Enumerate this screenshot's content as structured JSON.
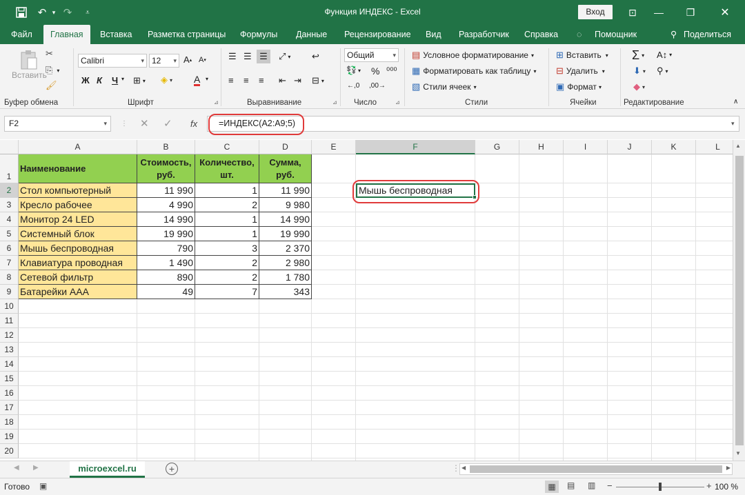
{
  "titlebar": {
    "title": "Функция ИНДЕКС  -  Excel",
    "login": "Вход"
  },
  "tabs": [
    "Файл",
    "Главная",
    "Вставка",
    "Разметка страницы",
    "Формулы",
    "Данные",
    "Рецензирование",
    "Вид",
    "Разработчик",
    "Справка",
    "Помощник",
    "Поделиться"
  ],
  "ribbon": {
    "paste": "Вставить",
    "font_name": "Calibri",
    "font_size": "12",
    "bold": "Ж",
    "italic": "К",
    "underline": "Ч",
    "number_format": "Общий",
    "cond_format": "Условное форматирование",
    "format_table": "Форматировать как таблицу",
    "cell_styles": "Стили ячеек",
    "insert": "Вставить",
    "delete": "Удалить",
    "format": "Формат",
    "groups": {
      "clipboard": "Буфер обмена",
      "font": "Шрифт",
      "alignment": "Выравнивание",
      "number": "Число",
      "styles": "Стили",
      "cells": "Ячейки",
      "editing": "Редактирование"
    }
  },
  "formula_bar": {
    "name_box": "F2",
    "fx": "fx",
    "formula": "=ИНДЕКС(A2:A9;5)"
  },
  "columns": [
    "A",
    "B",
    "C",
    "D",
    "E",
    "F",
    "G",
    "H",
    "I",
    "J",
    "K",
    "L"
  ],
  "rows": [
    "1",
    "2",
    "3",
    "4",
    "5",
    "6",
    "7",
    "8",
    "9",
    "10",
    "11",
    "12",
    "13",
    "14",
    "15",
    "16",
    "17",
    "18",
    "19",
    "20"
  ],
  "table": {
    "headers": [
      "Наименование",
      "Стоимость, руб.",
      "Количество, шт.",
      "Сумма, руб."
    ],
    "header_lines": [
      [
        "Наименование"
      ],
      [
        "Стоимость,",
        "руб."
      ],
      [
        "Количество,",
        "шт."
      ],
      [
        "Сумма,",
        "руб."
      ]
    ],
    "rows": [
      [
        "Стол компьютерный",
        "11 990",
        "1",
        "11 990"
      ],
      [
        "Кресло рабочее",
        "4 990",
        "2",
        "9 980"
      ],
      [
        "Монитор 24 LED",
        "14 990",
        "1",
        "14 990"
      ],
      [
        "Системный блок",
        "19 990",
        "1",
        "19 990"
      ],
      [
        "Мышь беспроводная",
        "790",
        "3",
        "2 370"
      ],
      [
        "Клавиатура проводная",
        "1 490",
        "2",
        "2 980"
      ],
      [
        "Сетевой фильтр",
        "890",
        "2",
        "1 780"
      ],
      [
        "Батарейки AAA",
        "49",
        "7",
        "343"
      ]
    ]
  },
  "result_cell": "Мышь беспроводная",
  "sheet_tab": "microexcel.ru",
  "status": {
    "ready": "Готово",
    "zoom": "100 %"
  }
}
